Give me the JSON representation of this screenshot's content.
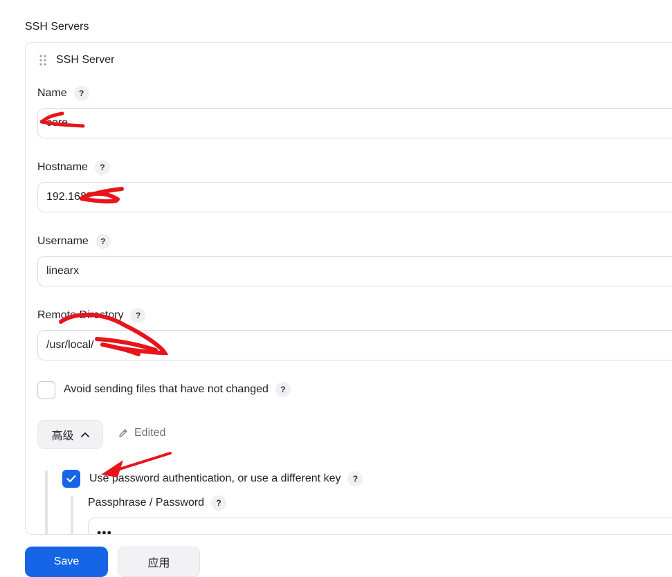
{
  "section": {
    "title": "SSH Servers"
  },
  "server": {
    "title": "SSH Server",
    "name": {
      "label": "Name",
      "value": "core"
    },
    "hostname": {
      "label": "Hostname",
      "value": "192.168"
    },
    "username": {
      "label": "Username",
      "value": "linearx"
    },
    "remote_directory": {
      "label": "Remote Directory",
      "value": "/usr/local/"
    },
    "avoid_sending": {
      "label": "Avoid sending files that have not changed",
      "checked": false
    },
    "advanced": {
      "label": "高级",
      "edited_label": "Edited"
    },
    "use_password": {
      "label": "Use password authentication, or use a different key",
      "checked": true
    },
    "passphrase": {
      "label": "Passphrase / Password",
      "value": "•••"
    }
  },
  "actions": {
    "save_label": "Save",
    "apply_label": "应用"
  },
  "colors": {
    "accent": "#1565e6",
    "annotation": "#e8141b"
  },
  "help_icon_text": "?"
}
